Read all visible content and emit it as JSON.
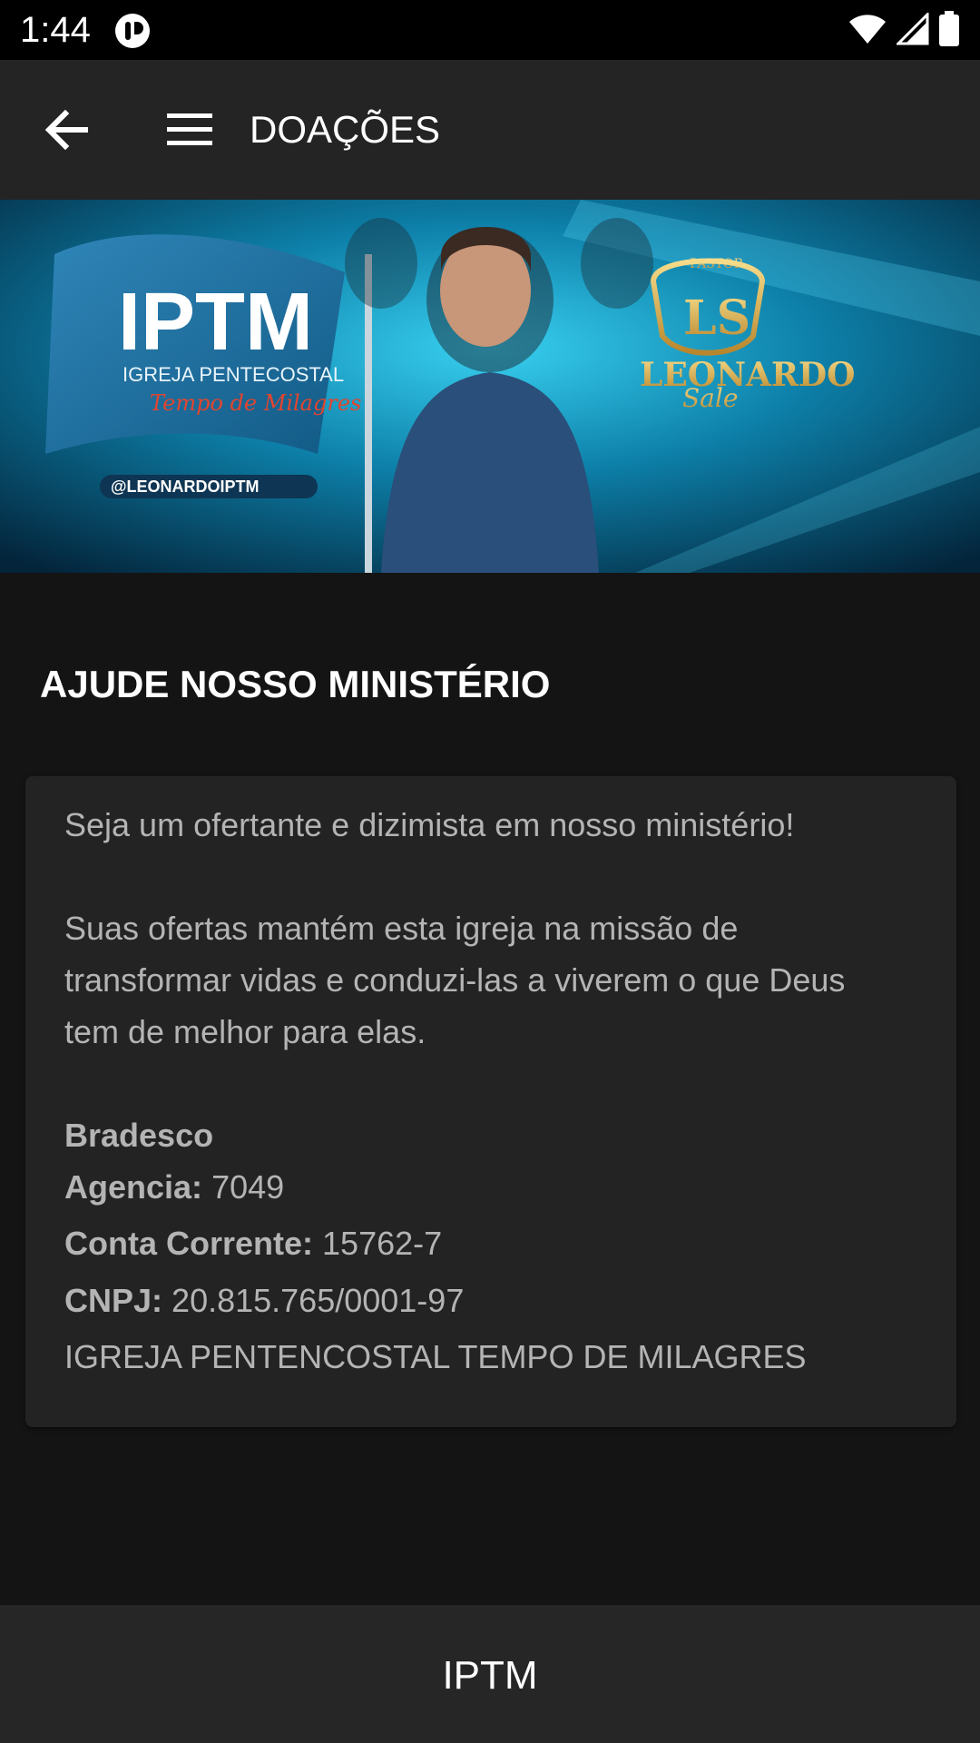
{
  "status_bar": {
    "time": "1:44"
  },
  "toolbar": {
    "title": "DOAÇÕES",
    "back_icon": "arrow-back-icon",
    "menu_icon": "hamburger-menu-icon"
  },
  "banner": {
    "church_logo": "IPTM",
    "church_subtitle": "IGREJA PENTECOSTAL",
    "church_tagline": "Tempo de Milagres",
    "pastor_label": "PASTOR",
    "pastor_monogram": "LS",
    "pastor_name": "LEONARDO",
    "pastor_surname": "Sale",
    "social_handle": "@LEONARDOIPTM"
  },
  "section": {
    "heading": "AJUDE NOSSO MINISTÉRIO"
  },
  "card": {
    "intro": "Seja um ofertante e dizimista em nosso ministério!",
    "paragraph_line1": "Suas ofertas mantém esta igreja na missão de",
    "paragraph_line2": "transformar vidas e conduzi-las a viverem o que Deus",
    "paragraph_line3": "tem de melhor para elas.",
    "bank_name": "Bradesco",
    "agency_label": "Agencia:",
    "agency_value": "7049",
    "account_label": "Conta Corrente:",
    "account_value": "15762-7",
    "cnpj_label": "CNPJ:",
    "cnpj_value": "20.815.765/0001-97",
    "organization": "IGREJA PENTENCOSTAL TEMPO DE MILAGRES"
  },
  "bottom_bar": {
    "title": "IPTM"
  },
  "colors": {
    "background": "#141414",
    "toolbar": "#242424",
    "card": "#232323",
    "banner_accent": "#1fb8e0",
    "gold": "#d9a94a"
  }
}
